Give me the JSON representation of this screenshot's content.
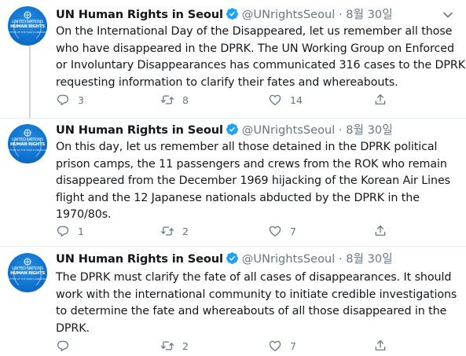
{
  "tweets": [
    {
      "name": "UN Human Rights in Seoul",
      "handle": "@UNrightsSeoul",
      "separator": "·",
      "date": "8월 30일",
      "lines": [
        "On the International Day of the Disappeared, let us remember all those",
        "who have disappeared in the DPRK. The UN Working Group on Enforced",
        "or Involuntary Disappearances has communicated 316 cases to the DPRK",
        "requesting information to clarify their fates and whereabouts."
      ],
      "replies": "3",
      "retweets": "8",
      "likes": "14"
    },
    {
      "name": "UN Human Rights in Seoul",
      "handle": "@UNrightsSeoul",
      "separator": "·",
      "date": "8월 30일",
      "lines": [
        "On this day, let us remember all those detained in the DPRK political",
        "prison camps, the 11 passengers and crews from the ROK who remain",
        "disappeared from the December 1969 hijacking of the Korean Air Lines",
        "flight and the 12 Japanese nationals abducted by the DPRK in the",
        "1970/80s."
      ],
      "replies": "1",
      "retweets": "2",
      "likes": "7"
    },
    {
      "name": "UN Human Rights in Seoul",
      "handle": "@UNrightsSeoul",
      "separator": "·",
      "date": "8월 30일",
      "lines": [
        "The DPRK must clarify the fate of all cases of disappearances. It should",
        "work with the international community to initiate credible investigations",
        "to determine the fate and whereabouts of all those disappeared in the",
        "DPRK."
      ],
      "replies": "",
      "retweets": "2",
      "likes": "7"
    }
  ],
  "avatar": {
    "line1": "UNITED NATIONS",
    "line2": "HUMAN RIGHTS",
    "line3": "OFFICE OF THE HIGH COMMISSIONER"
  },
  "icons": {
    "verified": "verified-badge-icon",
    "reply": "reply-icon",
    "retweet": "retweet-icon",
    "like": "heart-icon",
    "share": "share-icon",
    "menu": "chevron-down-icon"
  },
  "colors": {
    "text": "#14171a",
    "secondary": "#657786",
    "verified": "#1da1f2",
    "avatar": "#0a6cc9",
    "border": "#e6ecf0",
    "thread_line": "#ccd6dd"
  }
}
